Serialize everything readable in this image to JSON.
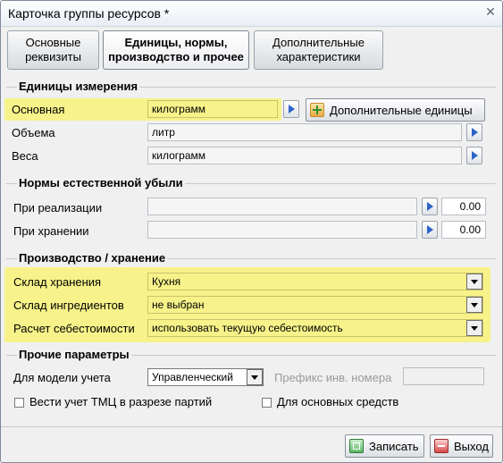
{
  "window": {
    "title": "Карточка группы ресурсов *"
  },
  "tabs": [
    {
      "label": "Основные\nреквизиты"
    },
    {
      "label": "Единицы, нормы,\nпроизводство и прочее"
    },
    {
      "label": "Дополнительные\nхарактеристики"
    }
  ],
  "units": {
    "section": "Единицы измерения",
    "main_label": "Основная",
    "main_value": "килограмм",
    "extra_button": "Дополнительные единицы",
    "volume_label": "Объема",
    "volume_value": "литр",
    "weight_label": "Веса",
    "weight_value": "килограмм"
  },
  "loss": {
    "section": "Нормы естественной убыли",
    "sale_label": "При реализации",
    "sale_value": "0.00",
    "storage_label": "При хранении",
    "storage_value": "0.00"
  },
  "production": {
    "section": "Производство / хранение",
    "warehouse_label": "Склад хранения",
    "warehouse_value": "Кухня",
    "ingredients_label": "Склад ингредиентов",
    "ingredients_value": "не выбран",
    "cost_label": "Расчет себестоимости",
    "cost_value": "использовать текущую себестоимость"
  },
  "other": {
    "section": "Прочие параметры",
    "model_label": "Для модели учета",
    "model_value": "Управленческий",
    "prefix_label": "Префикс инв. номера",
    "prefix_value": "",
    "batch_label": "Вести учет ТМЦ в разрезе партий",
    "fixed_assets_label": "Для основных средств"
  },
  "footer": {
    "save_label": "Записать",
    "exit_label": "Выход"
  },
  "colors": {
    "highlight": "#f7f38a",
    "arrow": "#2c63c7"
  }
}
